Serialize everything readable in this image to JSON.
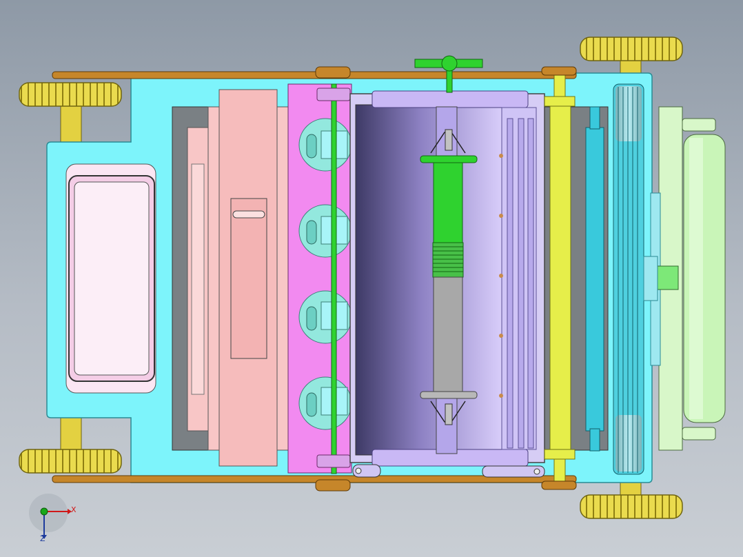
{
  "viewport": {
    "background_top": "#8e99a6",
    "background_bottom": "#c9ced4"
  },
  "model": {
    "colors": {
      "chassis": "#7df4fb",
      "chassis_dark": "#4fb8c0",
      "window": "#fbe6f3",
      "cavity": "#7a8084",
      "engine_block": "#f8c6c6",
      "manifold": "#f28af0",
      "cylinder_cap": "#93e8de",
      "drum": "#c9b8f5",
      "drum_dark": "#7c6bb8",
      "shaft_green": "#2fd22f",
      "shaft_gray": "#a8a8a8",
      "roller_yellow": "#e6ee4a",
      "roller_cyan": "#39c9dc",
      "back_roller": "#c9f5b8",
      "back_frame": "#d8f7c9",
      "belt": "#c6862a",
      "axle": "#e3d141",
      "tire": "#e8d84a",
      "tire_dark": "#8f7f12"
    },
    "icons": [
      "coordinate-triad-icon"
    ]
  },
  "triad": {
    "x_label": "X",
    "z_label": "Z",
    "x_color": "#d01818",
    "y_color": "#18a818",
    "z_color": "#1c3a9c"
  }
}
